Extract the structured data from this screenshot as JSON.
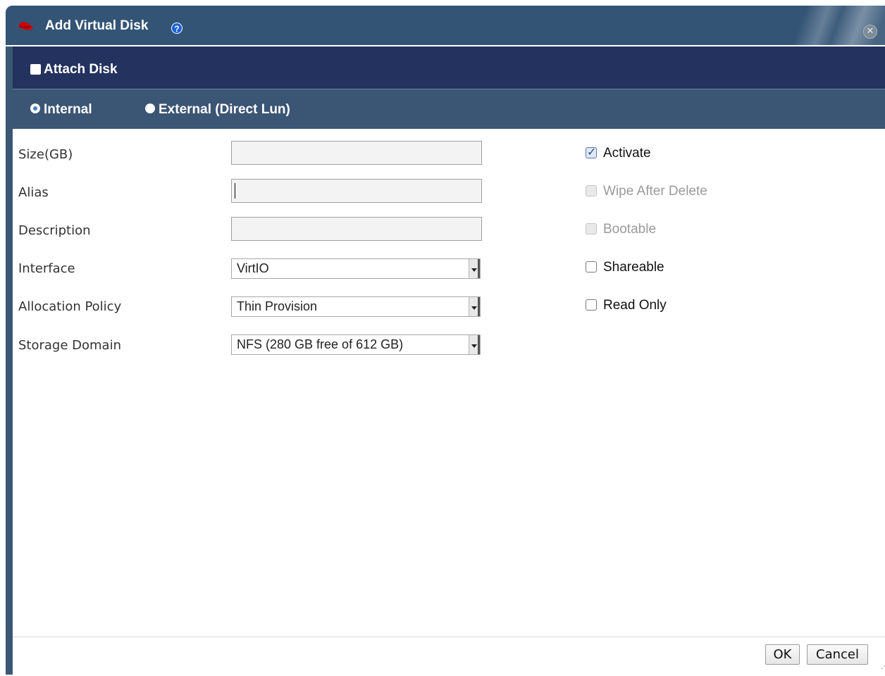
{
  "dialog": {
    "title": "Add Virtual Disk",
    "help_glyph": "?",
    "close_glyph": "✕",
    "brand_color": "#cc0000"
  },
  "attach": {
    "label": "Attach Disk",
    "checked": false
  },
  "disk_type": {
    "options": [
      {
        "label": "Internal",
        "selected": true
      },
      {
        "label": "External (Direct Lun)",
        "selected": false
      }
    ]
  },
  "fields": {
    "size": {
      "label": "Size(GB)",
      "value": ""
    },
    "alias": {
      "label": "Alias",
      "value": ""
    },
    "description": {
      "label": "Description",
      "value": ""
    },
    "interface": {
      "label": "Interface",
      "value": "VirtIO"
    },
    "allocation_policy": {
      "label": "Allocation Policy",
      "value": "Thin Provision"
    },
    "storage_domain": {
      "label": "Storage Domain",
      "value": "NFS (280 GB free of 612 GB)"
    }
  },
  "options": {
    "activate": {
      "label": "Activate",
      "checked": true,
      "disabled": false
    },
    "wipe_after_delete": {
      "label": "Wipe After Delete",
      "checked": false,
      "disabled": true
    },
    "bootable": {
      "label": "Bootable",
      "checked": false,
      "disabled": true
    },
    "shareable": {
      "label": "Shareable",
      "checked": false,
      "disabled": false
    },
    "read_only": {
      "label": "Read Only",
      "checked": false,
      "disabled": false
    }
  },
  "footer": {
    "ok_label": "OK",
    "cancel_label": "Cancel"
  }
}
